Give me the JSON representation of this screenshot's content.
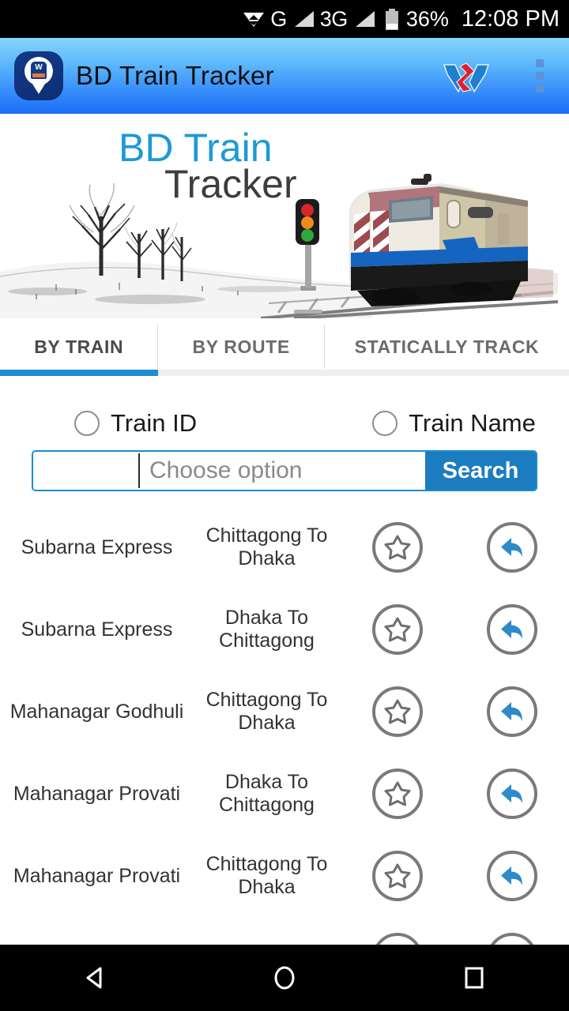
{
  "status_bar": {
    "network_g": "G",
    "network_3g": "3G",
    "battery": "36%",
    "time": "12:08 PM"
  },
  "app_bar": {
    "title": "BD Train Tracker",
    "logo_icon": "train-pin-logo-icon",
    "brand_icon": "w-brand-icon",
    "overflow_icon": "overflow-menu-icon"
  },
  "banner": {
    "title_line1": "BD Train",
    "title_line2": "Tracker",
    "title_color_primary": "#1d9ad6",
    "title_color_secondary": "#3d3d3d"
  },
  "tabs": {
    "active_index": 0,
    "indicator_color": "#1c8dce",
    "items": [
      {
        "label": "BY TRAIN"
      },
      {
        "label": "BY ROUTE"
      },
      {
        "label": "STATICALLY TRACK"
      }
    ]
  },
  "search_options": {
    "radios": [
      {
        "label": "Train ID",
        "selected": false
      },
      {
        "label": "Train Name",
        "selected": false
      }
    ],
    "input_value": "",
    "input_placeholder": "Choose option",
    "search_button": "Search",
    "accent_color": "#1c8dce"
  },
  "train_list": {
    "favorite_icon": "star-icon",
    "track_icon": "back-arrow-icon",
    "rows": [
      {
        "name": "Subarna Express",
        "route": "Chittagong To Dhaka"
      },
      {
        "name": "Subarna Express",
        "route": "Dhaka To Chittagong"
      },
      {
        "name": "Mahanagar Godhuli",
        "route": "Chittagong To Dhaka"
      },
      {
        "name": "Mahanagar Provati",
        "route": "Dhaka To Chittagong"
      },
      {
        "name": "Mahanagar Provati",
        "route": "Chittagong To Dhaka"
      },
      {
        "name": "",
        "route": ""
      }
    ]
  },
  "nav_bar": {
    "back_icon": "back-triangle-icon",
    "home_icon": "home-circle-icon",
    "recents_icon": "recents-square-icon"
  }
}
